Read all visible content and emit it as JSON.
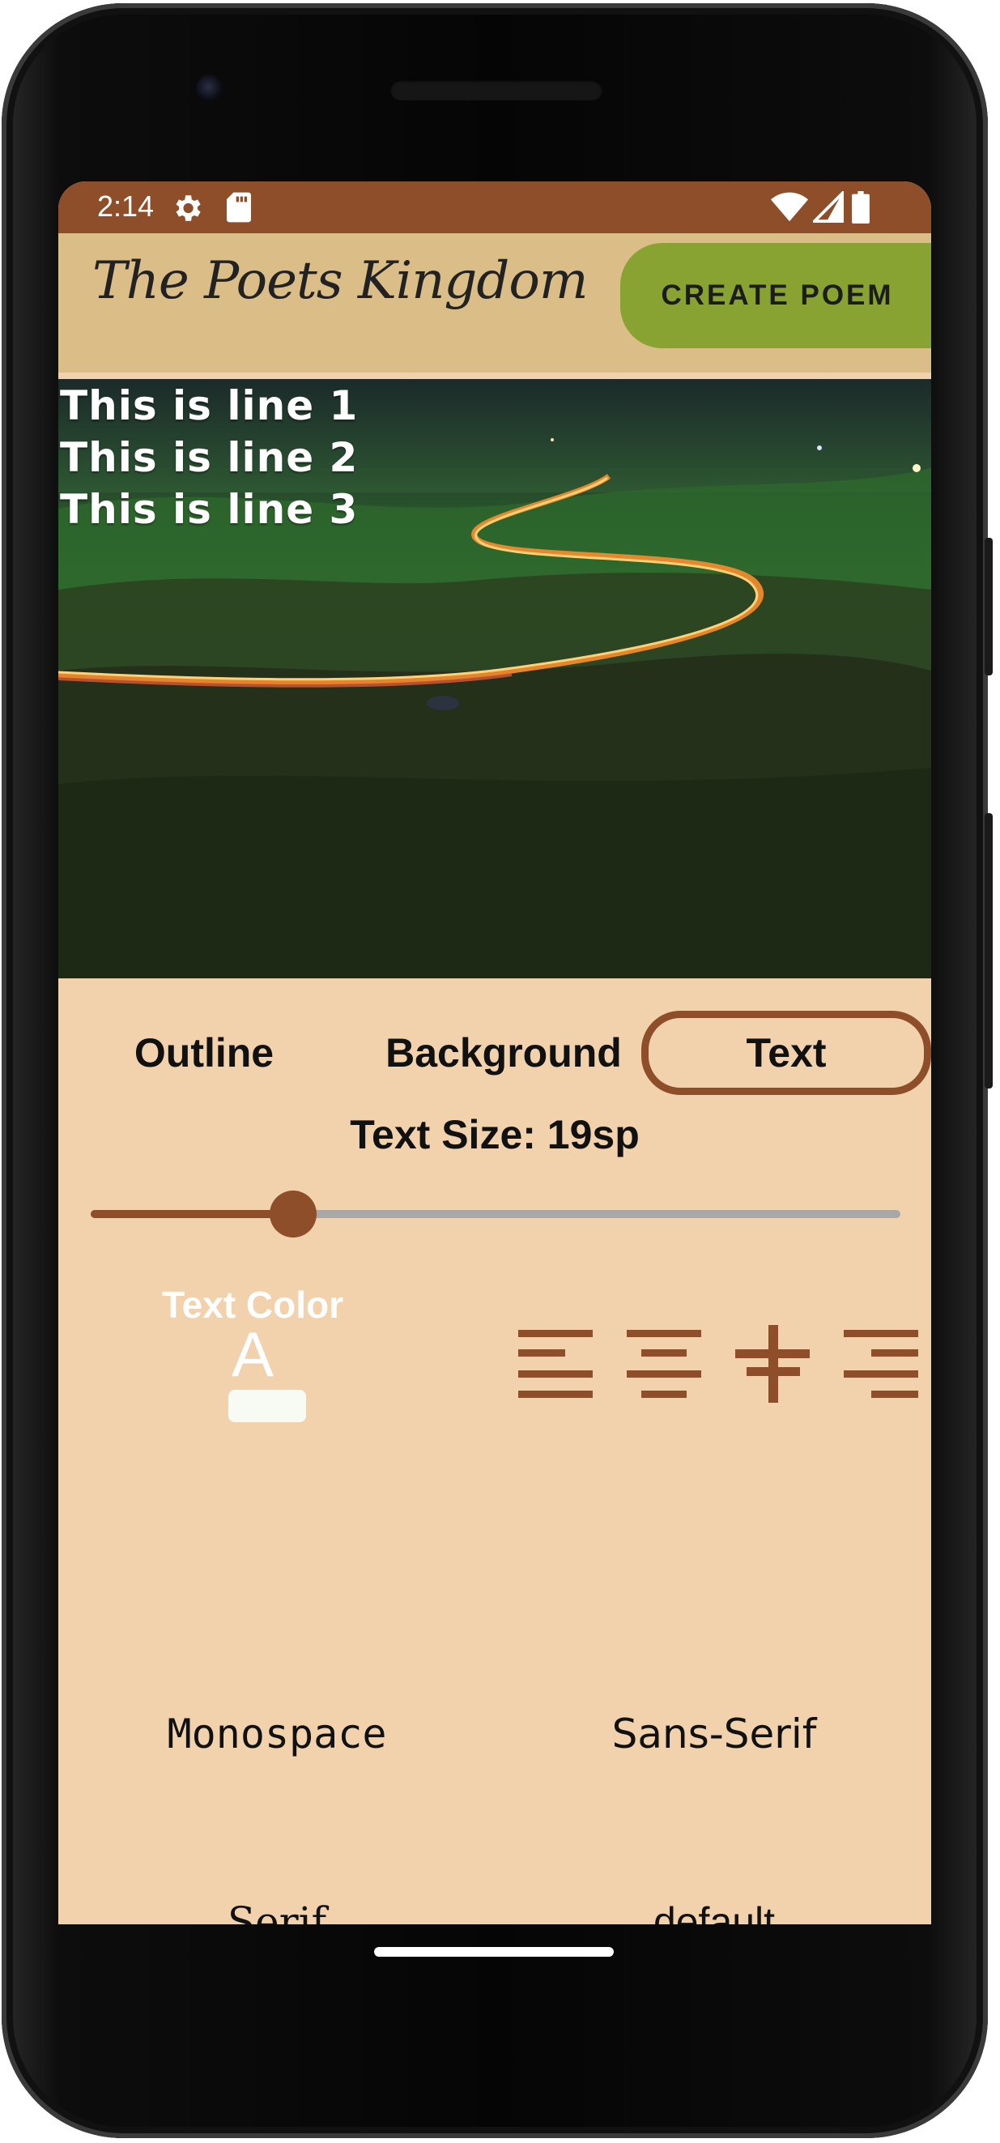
{
  "status_bar": {
    "time": "2:14",
    "icons": [
      "settings-icon",
      "sd-card-icon",
      "wifi-icon",
      "cell-signal-icon",
      "battery-icon"
    ]
  },
  "app_bar": {
    "title": "The Poets Kingdom",
    "create_button": "CREATE POEM"
  },
  "poem": {
    "lines": [
      "This is line 1",
      "This is line 2",
      "This is line 3"
    ]
  },
  "tabs": [
    {
      "label": "Outline",
      "active": false
    },
    {
      "label": "Background",
      "active": false
    },
    {
      "label": "Text",
      "active": true
    }
  ],
  "text_size": {
    "label": "Text Size: 19sp",
    "slider_fraction": 0.25
  },
  "text_color": {
    "label": "Text Color",
    "letter": "A",
    "swatch_color": "#f8fbf4"
  },
  "alignment_icons": [
    "align-left-icon",
    "align-center-icon",
    "align-vertical-center-icon",
    "align-right-icon"
  ],
  "fonts": [
    "Monospace",
    "Sans-Serif",
    "Serif",
    "default"
  ],
  "colors": {
    "brand_brown": "#8f4e2a",
    "app_bar_tan": "#dbbd88",
    "panel_peach": "#f1d2ad",
    "create_green": "#88a332"
  }
}
